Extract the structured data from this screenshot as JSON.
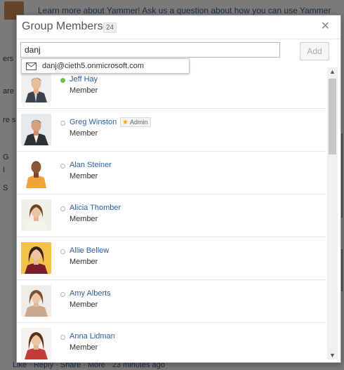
{
  "background": {
    "banner_text": "Learn more about Yammer! Ask us a question about how you can use Yammer",
    "side_fragments": [
      "ers",
      "are",
      "re s",
      "G",
      "I",
      "S"
    ],
    "footer_text": "Like · Reply · Share · More · 23 minutes ago"
  },
  "dialog": {
    "title": "Group Members",
    "count": "24",
    "close_icon": "close-icon"
  },
  "search": {
    "value": "danj",
    "add_label": "Add"
  },
  "suggestion": {
    "icon": "mail-icon",
    "email": "danj@cieth5.onmicrosoft.com"
  },
  "members": [
    {
      "name": "Jeff Hay",
      "role": "Member",
      "online": true,
      "badge": ""
    },
    {
      "name": "Greg Winston",
      "role": "Member",
      "online": false,
      "badge": "Admin"
    },
    {
      "name": "Alan Steiner",
      "role": "Member",
      "online": false,
      "badge": ""
    },
    {
      "name": "Alicia Thomber",
      "role": "Member",
      "online": false,
      "badge": ""
    },
    {
      "name": "Allie Bellew",
      "role": "Member",
      "online": false,
      "badge": ""
    },
    {
      "name": "Amy Alberts",
      "role": "Member",
      "online": false,
      "badge": ""
    },
    {
      "name": "Anna Lidman",
      "role": "Member",
      "online": false,
      "badge": ""
    }
  ],
  "colors": {
    "link": "#2b5f9e",
    "online": "#6fbf45",
    "admin_star": "#f2a900"
  }
}
